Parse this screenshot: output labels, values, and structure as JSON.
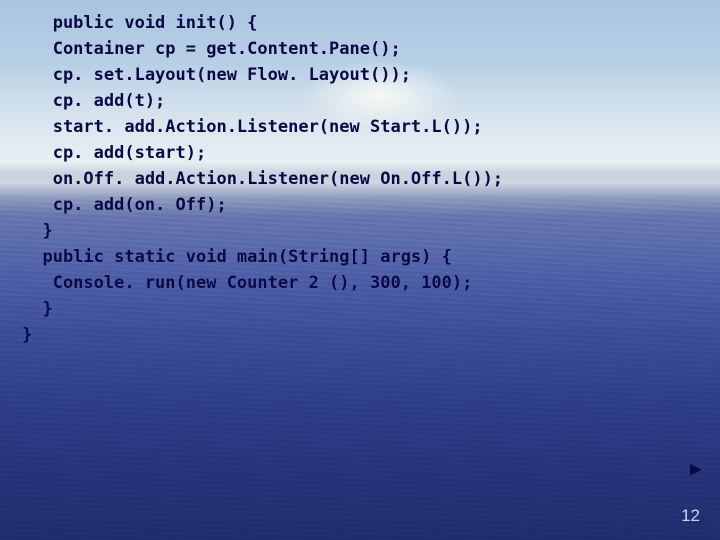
{
  "code": {
    "lines": [
      "   public void init() {",
      "   Container cp = get.Content.Pane();",
      "   cp. set.Layout(new Flow. Layout());",
      "   cp. add(t);",
      "   start. add.Action.Listener(new Start.L());",
      "   cp. add(start);",
      "   on.Off. add.Action.Listener(new On.Off.L());",
      "   cp. add(on. Off);",
      "  }",
      "  public static void main(String[] args) {",
      "   Console. run(new Counter 2 (), 300, 100);",
      "  }",
      "}"
    ]
  },
  "nav": {
    "next_glyph": "▶"
  },
  "page": {
    "number": "12"
  }
}
